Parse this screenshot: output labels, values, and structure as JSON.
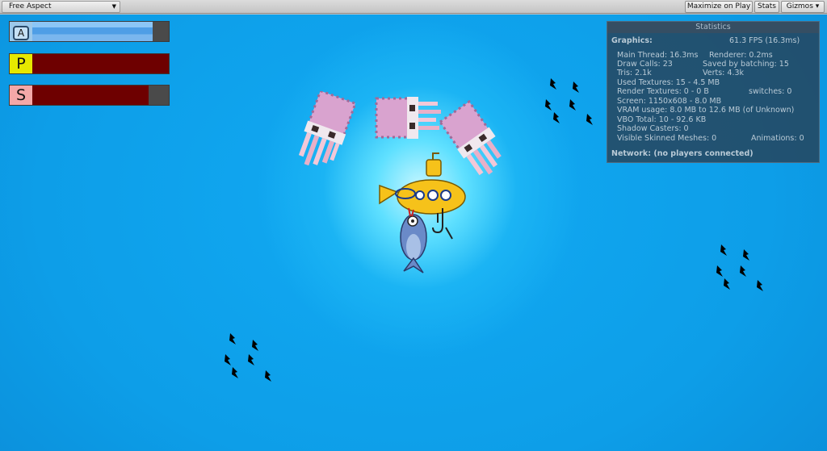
{
  "toolbar": {
    "aspect_label": "Free Aspect",
    "maximize_label": "Maximize on Play",
    "stats_label": "Stats",
    "gizmos_label": "Gizmos"
  },
  "hud": {
    "bars": [
      {
        "label": "A",
        "level": 0.88,
        "color": "#5aaaf0"
      },
      {
        "label": "P",
        "level": 1.0,
        "color": "#6e0000"
      },
      {
        "label": "S",
        "level": 0.85,
        "color": "#6e0000"
      }
    ]
  },
  "statistics": {
    "title": "Statistics",
    "graphics_label": "Graphics:",
    "fps": "61.3 FPS (16.3ms)",
    "main_thread": "Main Thread: 16.3ms",
    "renderer": "Renderer: 0.2ms",
    "draw_calls": "Draw Calls: 23",
    "saved_batching": "Saved by batching: 15",
    "tris": "Tris: 2.1k",
    "verts": "Verts: 4.3k",
    "used_textures": "Used Textures: 15 - 4.5 MB",
    "render_textures": "Render Textures: 0 - 0 B",
    "switches": "switches: 0",
    "screen": "Screen: 1150x608 - 8.0 MB",
    "vram": "VRAM usage: 8.0 MB to 12.6 MB (of Unknown)",
    "vbo": "VBO Total: 10 - 92.6 KB",
    "shadow_casters": "Shadow Casters: 0",
    "skinned_meshes": "Visible Skinned Meshes: 0",
    "animations": "Animations: 0",
    "network": "Network: (no players connected)"
  },
  "scene": {
    "colors": {
      "water": "#0d9ee8",
      "submarine": "#f6c21a",
      "squid": "#d9a3cf",
      "fish": "#000000"
    },
    "icons": [
      "submarine",
      "squid",
      "fish-school",
      "fish-with-hook"
    ]
  }
}
